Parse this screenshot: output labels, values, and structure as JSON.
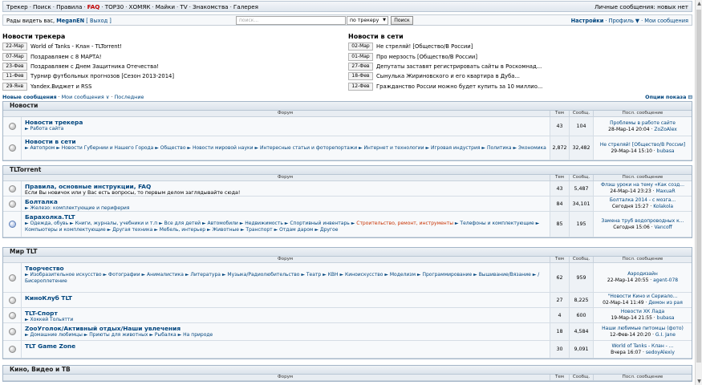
{
  "topbar": {
    "menu": [
      "Трекер",
      "Поиск",
      "Правила",
      "FAQ",
      "TOP30",
      "ХОМЯК",
      "Майки",
      "TV",
      "Знакомства",
      "Галерея"
    ],
    "pm": "Личные сообщения: новых нет"
  },
  "userbar": {
    "hello": "Рады видеть вас,",
    "user": "MeganEN",
    "logout": "[ Выход ]",
    "search_placeholder": "поиск...",
    "search_scope": "по трекеру",
    "search_button": "Поиск",
    "settings": "Настройки",
    "profile": "Профиль ▼",
    "my_messages": "Мои сообщения"
  },
  "tracker_news": {
    "title": "Новости трекера",
    "items": [
      {
        "date": "22-Мар",
        "title": "World of Tanks - Клан - TLTorrent!"
      },
      {
        "date": "07-Мар",
        "title": "Поздравляем с 8 МАРТА!"
      },
      {
        "date": "23-Фев",
        "title": "Поздравляем с Днем Защитника Отечества!"
      },
      {
        "date": "11-Фев",
        "title": "Турнир футбольных прогнозов [Сезон 2013-2014]"
      },
      {
        "date": "29-Янв",
        "title": "Yandex.Виджет и RSS"
      }
    ]
  },
  "net_news": {
    "title": "Новости в сети",
    "items": [
      {
        "date": "02-Мар",
        "title": "Не стреляй! [Общество/В России]"
      },
      {
        "date": "01-Мар",
        "title": "Про мерзость [Общество/В России]"
      },
      {
        "date": "27-Фев",
        "title": "Депутаты заставят регистрировать сайты в Роскомнад..."
      },
      {
        "date": "18-Фев",
        "title": "Сынулька Жириновского и его квартира в Дуба..."
      },
      {
        "date": "12-Фев",
        "title": "Гражданство России можно будет купить за 10 миллио..."
      }
    ]
  },
  "links": {
    "new_posts": "Новые сообщения",
    "my_posts": "Мои сообщения ∨",
    "latest": "Последние",
    "show_options": "Опции показа"
  },
  "columns": {
    "forum": "Форум",
    "topics": "Тем",
    "posts": "Сообщ.",
    "last": "Посл. сообщение"
  },
  "categories": [
    {
      "name": "Новости",
      "forums": [
        {
          "title": "Новости трекера",
          "subs": [
            "Работа сайта"
          ],
          "topics": "43",
          "posts": "104",
          "last_title": "Проблемы в работе сайте",
          "last_meta": "28-Мар-14 20:04 ·",
          "last_author": "ZoZoAlex",
          "new": false
        },
        {
          "title": "Новости в сети",
          "subs": [
            "Автопром",
            "Новости Губернии и Нашего Города",
            "Общество",
            "Новости мировой науки",
            "Интересные статьи и фоторепортажи",
            "Интернет и технологии",
            "Игровая индустрия",
            "Политика",
            "Экономика"
          ],
          "topics": "2,872",
          "posts": "32,482",
          "last_title": "Не стреляй! [Общество/В России]",
          "last_meta": "29-Мар-14 15:10 ·",
          "last_author": "bubasa",
          "new": false
        }
      ]
    },
    {
      "name": "TLTorrent",
      "forums": [
        {
          "title": "Правила, основные инструкции, FAQ",
          "desc": "Если Вы новичок или у Вас есть вопросы, то первым делом заглядывайте сюда!",
          "subs": [],
          "topics": "43",
          "posts": "5,487",
          "last_title": "Флэш уроки на тему «Как созд...",
          "last_meta": "24-Мар-14 23:23 ·",
          "last_author": "MaxuaR",
          "new": false
        },
        {
          "title": "Болталка",
          "subs": [
            "Железо: комплектующие и периферия"
          ],
          "topics": "84",
          "posts": "34,101",
          "last_title": "Болталка 2014 - с мозга...",
          "last_meta": "Сегодня 15:27 ·",
          "last_author": "Kolakola",
          "new": false
        },
        {
          "title": "Барахолка.TLT",
          "subs": [
            "Одежда, обувь",
            "Книги, журналы, учебники и т.п",
            "Все для детей",
            "Автомобили",
            "Недвижимость",
            "Спортивный инвентарь",
            "Строительство, ремонт, инструменты",
            "Телефоны и комплектующие",
            "Компьютеры и комплектующие",
            "Другая техника",
            "Мебель, интерьер",
            "Животные",
            "Транспорт",
            "Отдам даром",
            "Другое"
          ],
          "highlight_sub": "Строительство, ремонт, инструменты",
          "topics": "85",
          "posts": "195",
          "last_title": "Замена труб водопроводных к...",
          "last_meta": "Сегодня 15:06 ·",
          "last_author": "Vancoff",
          "new": true
        }
      ]
    },
    {
      "name": "Мир TLT",
      "forums": [
        {
          "title": "Творчество",
          "subs": [
            "Изобразительное искусство",
            "Фотографии",
            "Анималистика",
            "Литература",
            "Музыка/Радиолюбительство",
            "Театр",
            "КВН",
            "Киноискусство",
            "Моделизм",
            "Программирование",
            "Вышивание/Вязание",
            "/Бисероплетение"
          ],
          "topics": "62",
          "posts": "959",
          "last_title": "Аэродизайн",
          "last_meta": "22-Мар-14 20:55 ·",
          "last_author": "agent-078",
          "new": false
        },
        {
          "title": "КиноКлуб TLT",
          "subs": [],
          "topics": "27",
          "posts": "8,225",
          "last_title": "\"Новости Кино и Сериало...",
          "last_meta": "02-Мар-14 11:49 ·",
          "last_author": "Демон из рая",
          "new": false
        },
        {
          "title": "TLT-Спорт",
          "subs": [
            "Хоккей Тольятти"
          ],
          "topics": "4",
          "posts": "600",
          "last_title": "Новости ХК Лада",
          "last_meta": "19-Мар-14 21:55 ·",
          "last_author": "bubasa",
          "new": false
        },
        {
          "title": "ZooУголок/Активный отдых/Наши увлечения",
          "subs": [
            "Домашние любимцы",
            "Приюты для животных",
            "Рыбалка",
            "На природе"
          ],
          "topics": "18",
          "posts": "4,584",
          "last_title": "Наши любимые питомцы (фото)",
          "last_meta": "12-Фев-14 20:20 ·",
          "last_author": "G.I. Jane",
          "new": false
        },
        {
          "title": "TLT Game Zone",
          "subs": [],
          "topics": "30",
          "posts": "9,091",
          "last_title": "World of Tanks - Клан - ...",
          "last_meta": "Вчера 16:07 ·",
          "last_author": "sedoyAlexiy",
          "new": false
        }
      ]
    },
    {
      "name": "Кино, Видео и ТВ",
      "forums": []
    }
  ]
}
